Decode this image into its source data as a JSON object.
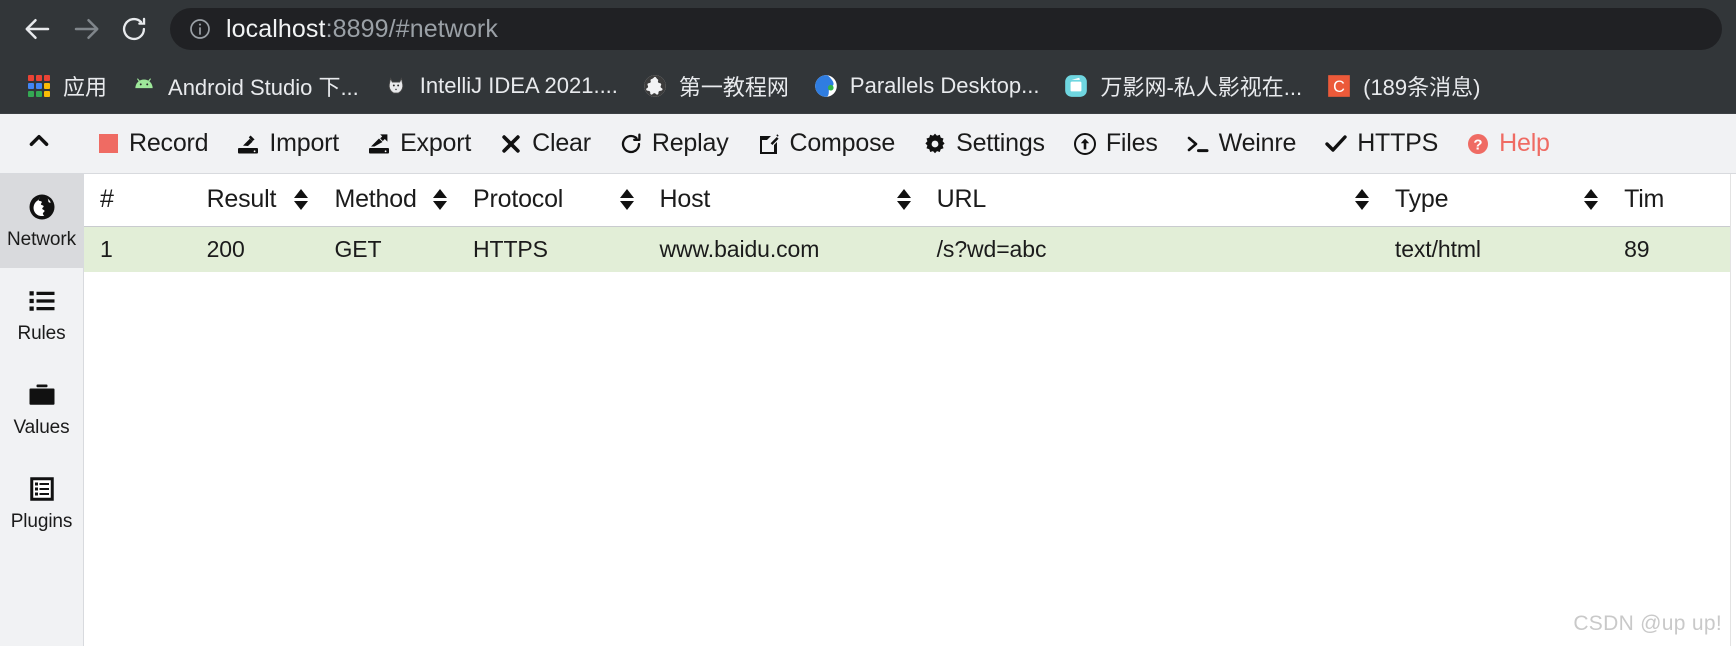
{
  "browser": {
    "nav": {
      "back_icon": "arrow-left-icon",
      "forward_icon": "arrow-right-icon",
      "reload_icon": "reload-icon",
      "info_icon": "info-circle-icon"
    },
    "omnibox": {
      "host": "localhost",
      "path": ":8899/#network",
      "full_url": "localhost:8899/#network"
    },
    "bookmarks": [
      {
        "label": "应用",
        "icon": "apps-grid-icon"
      },
      {
        "label": "Android Studio 下...",
        "icon": "android-icon"
      },
      {
        "label": "IntelliJ IDEA 2021....",
        "icon": "husky-icon"
      },
      {
        "label": "第一教程网",
        "icon": "globe-icon"
      },
      {
        "label": "Parallels Desktop...",
        "icon": "parallels-icon"
      },
      {
        "label": "万影网-私人影视在...",
        "icon": "film-icon"
      },
      {
        "label": "(189条消息)",
        "icon": "csdn-icon"
      }
    ]
  },
  "toolbar": {
    "collapse_icon": "chevron-up-icon",
    "items": [
      {
        "label": "Record",
        "icon": "record-square-icon"
      },
      {
        "label": "Import",
        "icon": "import-icon"
      },
      {
        "label": "Export",
        "icon": "export-icon"
      },
      {
        "label": "Clear",
        "icon": "cross-icon"
      },
      {
        "label": "Replay",
        "icon": "refresh-icon"
      },
      {
        "label": "Compose",
        "icon": "compose-icon"
      },
      {
        "label": "Settings",
        "icon": "gear-icon"
      },
      {
        "label": "Files",
        "icon": "upload-circle-icon"
      },
      {
        "label": "Weinre",
        "icon": "terminal-icon"
      },
      {
        "label": "HTTPS",
        "icon": "check-icon"
      },
      {
        "label": "Help",
        "icon": "question-circle-icon"
      }
    ]
  },
  "sidebar": {
    "items": [
      {
        "label": "Network",
        "icon": "globe-icon",
        "active": true
      },
      {
        "label": "Rules",
        "icon": "list-icon",
        "active": false
      },
      {
        "label": "Values",
        "icon": "folder-icon",
        "active": false
      },
      {
        "label": "Plugins",
        "icon": "plugin-icon",
        "active": false
      }
    ]
  },
  "table": {
    "columns": [
      {
        "label": "#",
        "sortable": false
      },
      {
        "label": "Result",
        "sortable": true
      },
      {
        "label": "Method",
        "sortable": true
      },
      {
        "label": "Protocol",
        "sortable": true
      },
      {
        "label": "Host",
        "sortable": true
      },
      {
        "label": "URL",
        "sortable": true
      },
      {
        "label": "Type",
        "sortable": true
      },
      {
        "label": "Tim",
        "sortable": false
      }
    ],
    "rows": [
      {
        "index": "1",
        "result": "200",
        "method": "GET",
        "protocol": "HTTPS",
        "host": "www.baidu.com",
        "url": "/s?wd=abc",
        "type": "text/html",
        "time": "89"
      }
    ]
  },
  "watermark": "CSDN @up up!",
  "colors": {
    "chrome_bg": "#323639",
    "omnibox_bg": "#202124",
    "toolbar_bg": "#f1f2f4",
    "accent_red": "#ef6b63",
    "row_green": "#e2eed7",
    "sidebar_active": "#d9dadd"
  }
}
